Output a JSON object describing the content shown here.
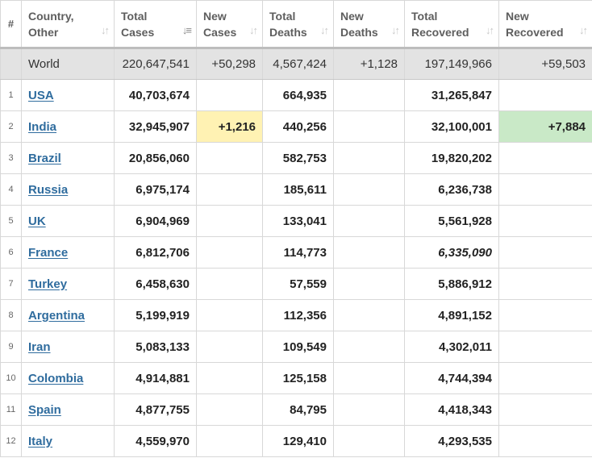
{
  "headers": {
    "num": "#",
    "country": [
      "Country,",
      "Other"
    ],
    "total_cases": [
      "Total",
      "Cases"
    ],
    "new_cases": [
      "New",
      "Cases"
    ],
    "total_deaths": [
      "Total",
      "Deaths"
    ],
    "new_deaths": [
      "New",
      "Deaths"
    ],
    "total_recovered": [
      "Total",
      "Recovered"
    ],
    "new_recovered": [
      "New",
      "Recovered"
    ],
    "sort_icon": "↓↑",
    "sort_icon_active": "↓≡"
  },
  "world": {
    "country": "World",
    "total_cases": "220,647,541",
    "new_cases": "+50,298",
    "total_deaths": "4,567,424",
    "new_deaths": "+1,128",
    "total_recovered": "197,149,966",
    "new_recovered": "+59,503"
  },
  "rows": [
    {
      "num": "1",
      "country": "USA",
      "total_cases": "40,703,674",
      "new_cases": "",
      "total_deaths": "664,935",
      "new_deaths": "",
      "total_recovered": "31,265,847",
      "new_recovered": ""
    },
    {
      "num": "2",
      "country": "India",
      "total_cases": "32,945,907",
      "new_cases": "+1,216",
      "total_deaths": "440,256",
      "new_deaths": "",
      "total_recovered": "32,100,001",
      "new_recovered": "+7,884"
    },
    {
      "num": "3",
      "country": "Brazil",
      "total_cases": "20,856,060",
      "new_cases": "",
      "total_deaths": "582,753",
      "new_deaths": "",
      "total_recovered": "19,820,202",
      "new_recovered": ""
    },
    {
      "num": "4",
      "country": "Russia",
      "total_cases": "6,975,174",
      "new_cases": "",
      "total_deaths": "185,611",
      "new_deaths": "",
      "total_recovered": "6,236,738",
      "new_recovered": ""
    },
    {
      "num": "5",
      "country": "UK",
      "total_cases": "6,904,969",
      "new_cases": "",
      "total_deaths": "133,041",
      "new_deaths": "",
      "total_recovered": "5,561,928",
      "new_recovered": ""
    },
    {
      "num": "6",
      "country": "France",
      "total_cases": "6,812,706",
      "new_cases": "",
      "total_deaths": "114,773",
      "new_deaths": "",
      "total_recovered": "6,335,090",
      "new_recovered": ""
    },
    {
      "num": "7",
      "country": "Turkey",
      "total_cases": "6,458,630",
      "new_cases": "",
      "total_deaths": "57,559",
      "new_deaths": "",
      "total_recovered": "5,886,912",
      "new_recovered": ""
    },
    {
      "num": "8",
      "country": "Argentina",
      "total_cases": "5,199,919",
      "new_cases": "",
      "total_deaths": "112,356",
      "new_deaths": "",
      "total_recovered": "4,891,152",
      "new_recovered": ""
    },
    {
      "num": "9",
      "country": "Iran",
      "total_cases": "5,083,133",
      "new_cases": "",
      "total_deaths": "109,549",
      "new_deaths": "",
      "total_recovered": "4,302,011",
      "new_recovered": ""
    },
    {
      "num": "10",
      "country": "Colombia",
      "total_cases": "4,914,881",
      "new_cases": "",
      "total_deaths": "125,158",
      "new_deaths": "",
      "total_recovered": "4,744,394",
      "new_recovered": ""
    },
    {
      "num": "11",
      "country": "Spain",
      "total_cases": "4,877,755",
      "new_cases": "",
      "total_deaths": "84,795",
      "new_deaths": "",
      "total_recovered": "4,418,343",
      "new_recovered": ""
    },
    {
      "num": "12",
      "country": "Italy",
      "total_cases": "4,559,970",
      "new_cases": "",
      "total_deaths": "129,410",
      "new_deaths": "",
      "total_recovered": "4,293,535",
      "new_recovered": ""
    }
  ],
  "colors": {
    "link": "#2f6c9e",
    "new_cases_highlight": "#fff2b3",
    "new_recovered_highlight": "#c9e9c7",
    "world_row_bg": "#e3e3e3",
    "estimated_recovered": "#8a8a8a"
  }
}
